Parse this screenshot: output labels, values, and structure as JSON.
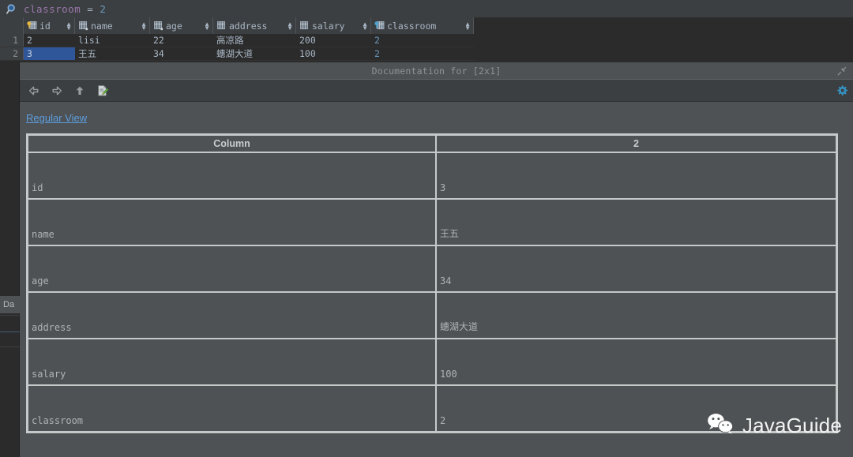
{
  "filter_bar": {
    "icon": "search-icon",
    "column": "classroom",
    "operator": " = ",
    "value": "2",
    "full_text": "classroom = 2"
  },
  "grid": {
    "columns": [
      {
        "name": "id",
        "icon": "primary-key-icon",
        "width": 65,
        "sort_indicator": "↕"
      },
      {
        "name": "name",
        "icon": "column-icon",
        "width": 95,
        "sort_indicator": "↕"
      },
      {
        "name": "age",
        "icon": "column-icon",
        "width": 80,
        "sort_indicator": "↕"
      },
      {
        "name": "address",
        "icon": "column-icon",
        "width": 105,
        "sort_indicator": "↕"
      },
      {
        "name": "salary",
        "icon": "column-icon",
        "width": 95,
        "sort_indicator": "↕"
      },
      {
        "name": "classroom",
        "icon": "foreign-key-icon",
        "width": 130,
        "sort_indicator": "↕"
      }
    ],
    "rows": [
      {
        "number": "1",
        "cells": [
          "2",
          "lisi",
          "22",
          "高凉路",
          "200",
          "2"
        ],
        "selected_index": -1
      },
      {
        "number": "2",
        "cells": [
          "3",
          "王五",
          "34",
          "蟪湖大道",
          "100",
          "2"
        ],
        "selected_index": 0
      }
    ]
  },
  "left_strip": {
    "tab_label": "Da"
  },
  "doc_panel": {
    "title": "Documentation for [2x1]",
    "pin_icon": "pin-icon",
    "toolbar": {
      "back_icon": "arrow-left-icon",
      "forward_icon": "arrow-right-icon",
      "up_icon": "arrow-up-icon",
      "edit_icon": "edit-document-icon",
      "settings_icon": "gear-icon"
    },
    "regular_view_link": "Regular View",
    "table": {
      "headers": [
        "Column",
        "2"
      ],
      "rows": [
        {
          "column": "id",
          "value": "3"
        },
        {
          "column": "name",
          "value": "王五"
        },
        {
          "column": "age",
          "value": "34"
        },
        {
          "column": "address",
          "value": "蟪湖大道"
        },
        {
          "column": "salary",
          "value": "100"
        },
        {
          "column": "classroom",
          "value": "2"
        }
      ]
    }
  },
  "watermark": {
    "icon": "wechat-icon",
    "text": "JavaGuide"
  },
  "colors": {
    "accent_blue": "#6897bb",
    "link_blue": "#5c9de0",
    "selection_blue": "#2f5699",
    "panel_bg": "#4e5254",
    "grid_bg": "#2b2b2b",
    "toolbar_bg": "#3c3f41",
    "text": "#a9b7c6",
    "key_gold": "#e8bb40"
  }
}
